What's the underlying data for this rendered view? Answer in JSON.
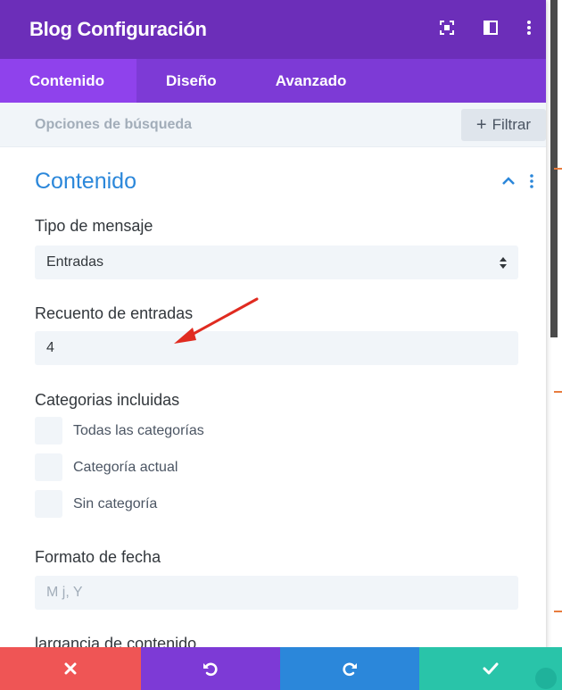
{
  "header": {
    "title": "Blog Configuración",
    "icons": [
      "focus-icon",
      "layout-icon",
      "more-vertical-icon"
    ]
  },
  "tabs": [
    {
      "label": "Contenido",
      "active": true
    },
    {
      "label": "Diseño",
      "active": false
    },
    {
      "label": "Avanzado",
      "active": false
    }
  ],
  "filterbar": {
    "search_placeholder": "Opciones de búsqueda",
    "filter_label": "Filtrar"
  },
  "section": {
    "title": "Contenido"
  },
  "fields": {
    "post_type": {
      "label": "Tipo de mensaje",
      "value": "Entradas"
    },
    "post_count": {
      "label": "Recuento de entradas",
      "value": "4"
    },
    "categories": {
      "label": "Categorias incluidas",
      "options": [
        "Todas las categorías",
        "Categoría actual",
        "Sin categoría"
      ]
    },
    "date_format": {
      "label": "Formato de fecha",
      "placeholder": "M j, Y"
    },
    "content_length": {
      "label": "largancia de contenido"
    }
  },
  "footer": {
    "buttons": [
      "close-icon",
      "undo-icon",
      "redo-icon",
      "check-icon"
    ]
  },
  "colors": {
    "header": "#6c2eb9",
    "tabs": "#7d3ad6",
    "active_tab": "#8f42ec",
    "accent_blue": "#2b87da",
    "cancel": "#ef5555",
    "save": "#29c4a9",
    "annotation_arrow": "#e02b20"
  }
}
